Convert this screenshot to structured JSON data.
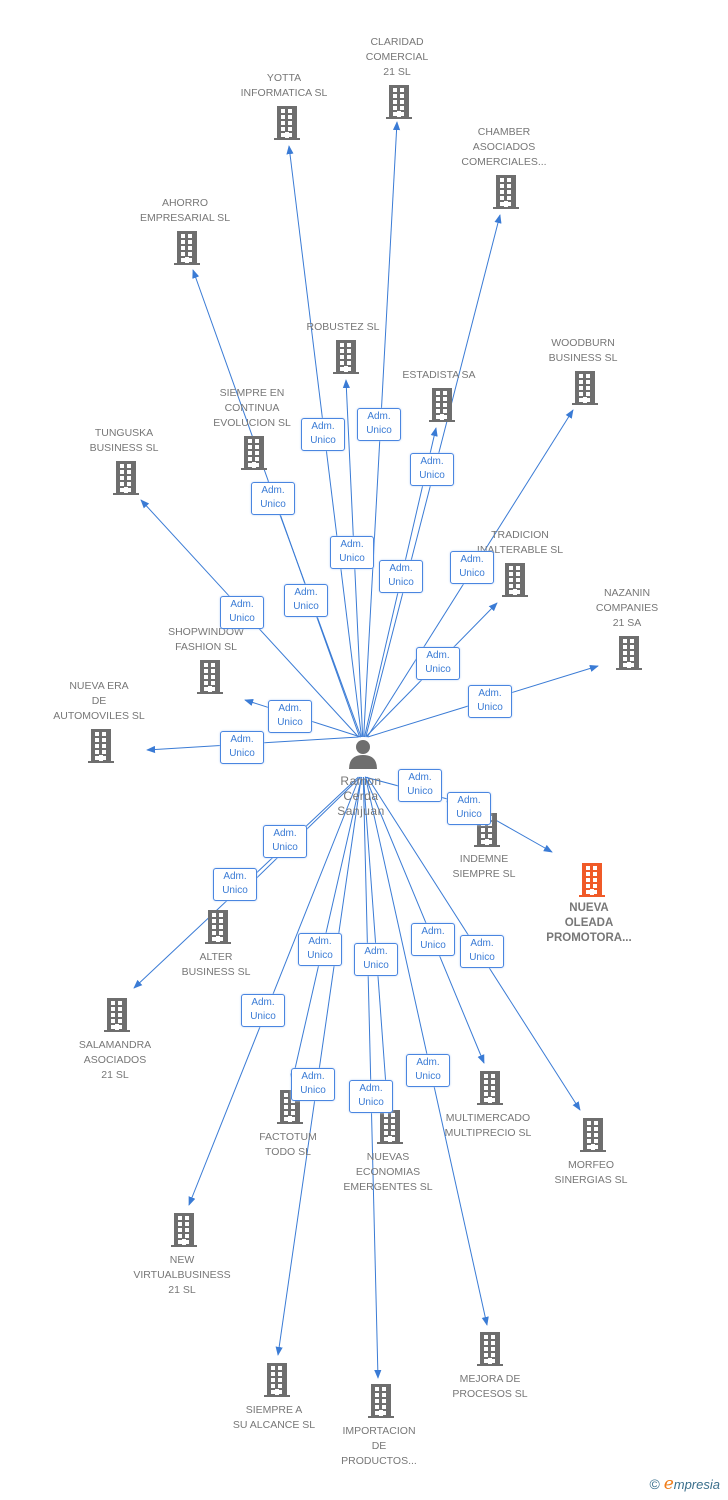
{
  "center": {
    "name": "Ramon Cerda Sanjuan",
    "lines": [
      "Ramon",
      "Cerda",
      "Sanjuan"
    ],
    "icon": "person-icon"
  },
  "relation_label": [
    "Adm.",
    "Unico"
  ],
  "colors": {
    "edge": "#3a7bd5",
    "company": "#6e6e6e",
    "focus": "#f05a28"
  },
  "nodes": [
    {
      "lines": [
        "CLARIDAD",
        "COMERCIAL",
        "21 SL"
      ]
    },
    {
      "lines": [
        "YOTTA",
        "INFORMATICA SL"
      ]
    },
    {
      "lines": [
        "CHAMBER",
        "ASOCIADOS",
        "COMERCIALES..."
      ]
    },
    {
      "lines": [
        "AHORRO",
        "EMPRESARIAL SL"
      ]
    },
    {
      "lines": [
        "ROBUSTEZ SL"
      ]
    },
    {
      "lines": [
        "WOODBURN",
        "BUSINESS SL"
      ]
    },
    {
      "lines": [
        "ESTADISTA SA"
      ]
    },
    {
      "lines": [
        "SIEMPRE EN",
        "CONTINUA",
        "EVOLUCION SL"
      ]
    },
    {
      "lines": [
        "TUNGUSKA",
        "BUSINESS SL"
      ]
    },
    {
      "lines": [
        "TRADICION",
        "INALTERABLE SL"
      ]
    },
    {
      "lines": [
        "NAZANIN",
        "COMPANIES",
        "21 SA"
      ]
    },
    {
      "lines": [
        "SHOPWINDOW",
        "FASHION SL"
      ]
    },
    {
      "lines": [
        "NUEVA ERA",
        "DE",
        "AUTOMOVILES SL"
      ]
    },
    {
      "lines": [
        "INDEMNE",
        "SIEMPRE SL"
      ]
    },
    {
      "lines": [
        "NUEVA",
        "OLEADA",
        "PROMOTORA..."
      ],
      "focus": true
    },
    {
      "lines": [
        "ALTER",
        "BUSINESS SL"
      ]
    },
    {
      "lines": [
        "SALAMANDRA",
        "ASOCIADOS",
        "21 SL"
      ]
    },
    {
      "lines": [
        "MULTIMERCADO",
        "MULTIPRECIO SL"
      ]
    },
    {
      "lines": [
        "MORFEO",
        "SINERGIAS SL"
      ]
    },
    {
      "lines": [
        "FACTOTUM",
        "TODO SL"
      ]
    },
    {
      "lines": [
        "NUEVAS",
        "ECONOMIAS",
        "EMERGENTES SL"
      ]
    },
    {
      "lines": [
        "NEW",
        "VIRTUALBUSINESS",
        "21 SL"
      ]
    },
    {
      "lines": [
        "MEJORA DE",
        "PROCESOS SL"
      ]
    },
    {
      "lines": [
        "SIEMPRE A",
        "SU ALCANCE SL"
      ]
    },
    {
      "lines": [
        "IMPORTACION",
        "DE",
        "PRODUCTOS..."
      ]
    }
  ],
  "edges_from_center": [
    0,
    1,
    2,
    3,
    4,
    5,
    6,
    7,
    8,
    9,
    10,
    11,
    12,
    13,
    15,
    16,
    17,
    18,
    19,
    20,
    21,
    22,
    23,
    24
  ],
  "edge_indemne_to_focus": {
    "from": 13,
    "to": 14
  },
  "footer": {
    "copyright": "©",
    "brand_initial": "e",
    "brand_rest": "mpresia"
  }
}
